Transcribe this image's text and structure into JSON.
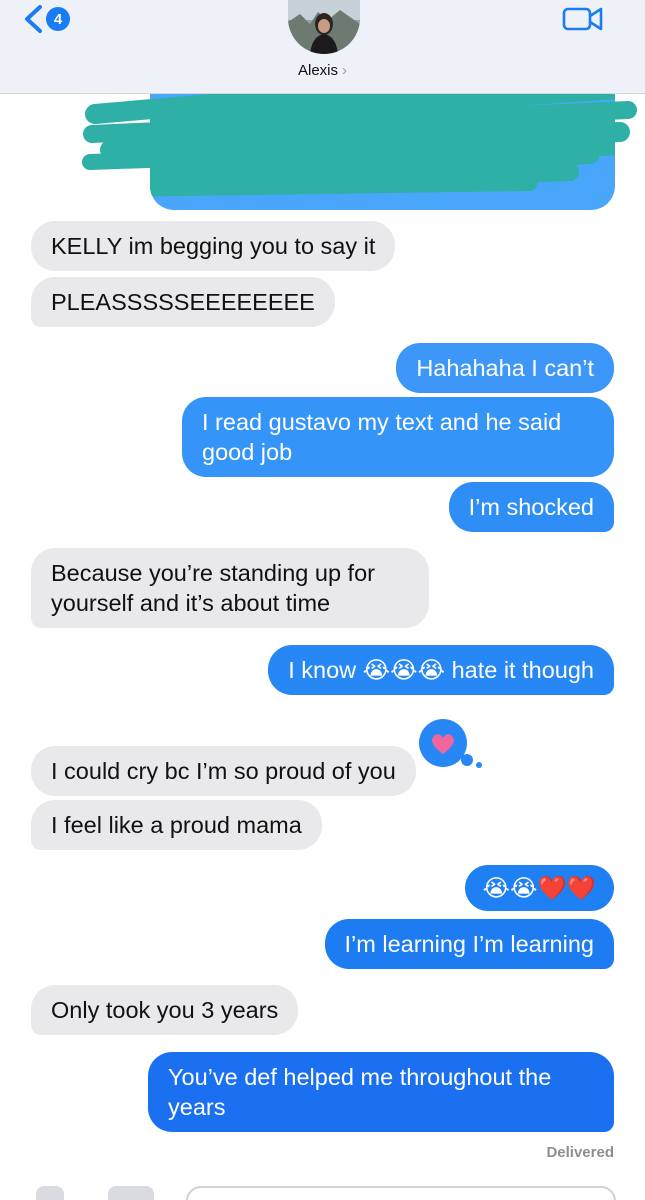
{
  "header": {
    "unread_count": "4",
    "contact_name": "Alexis",
    "name_chevron": "›"
  },
  "messages": [
    {
      "from": "them",
      "text": "KELLY im begging you to say it"
    },
    {
      "from": "them",
      "text": "PLEASSSSSEEEEEEEE"
    },
    {
      "from": "me",
      "text": "Hahahaha I can’t"
    },
    {
      "from": "me",
      "text": "I read gustavo my text and he said good job"
    },
    {
      "from": "me",
      "text": "I’m shocked"
    },
    {
      "from": "them",
      "text": "Because you’re standing up for yourself and it’s about time"
    },
    {
      "from": "me",
      "text": "I know 😭😭😭 hate it though"
    },
    {
      "from": "them",
      "text": "I could cry bc I’m so proud of you",
      "reaction": "heart"
    },
    {
      "from": "them",
      "text": "I feel like a proud mama"
    },
    {
      "from": "me",
      "text": "😭😭❤️❤️"
    },
    {
      "from": "me",
      "text": "I’m learning I’m learning"
    },
    {
      "from": "them",
      "text": "Only took you 3 years"
    },
    {
      "from": "me",
      "text": "You’ve def helped me throughout the years"
    }
  ],
  "status": {
    "delivered": "Delivered"
  },
  "icons": {
    "back": "chevron-left-icon",
    "video": "video-camera-icon",
    "reaction": "heart-icon"
  },
  "colors": {
    "outgoing_top": "#4aa6fb",
    "outgoing_bottom": "#1a70f0",
    "incoming": "#e9e9eb",
    "scribble": "#2fb0a6",
    "accent": "#1a7cf5"
  }
}
